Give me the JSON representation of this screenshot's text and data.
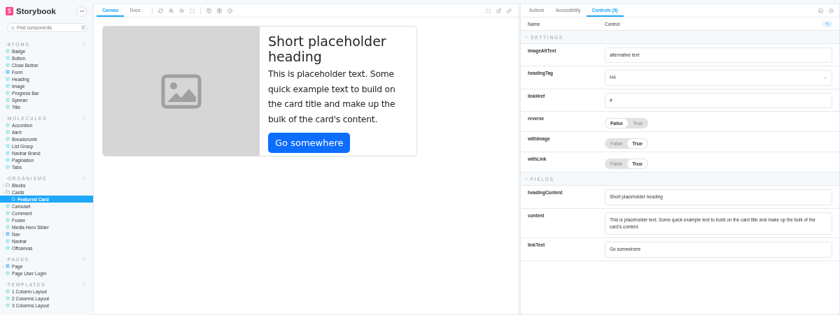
{
  "sidebar": {
    "brand": "Storybook",
    "search": {
      "placeholder": "Find components",
      "shortcut": "/"
    },
    "sections": [
      {
        "title": "ATOMS",
        "items": [
          {
            "label": "Badge",
            "kind": "component",
            "selected": false
          },
          {
            "label": "Button",
            "kind": "component",
            "selected": false
          },
          {
            "label": "Close Button",
            "kind": "component",
            "selected": false
          },
          {
            "label": "Form",
            "kind": "group",
            "expanded": false,
            "selected": false
          },
          {
            "label": "Heading",
            "kind": "component",
            "selected": false
          },
          {
            "label": "Image",
            "kind": "component",
            "selected": false
          },
          {
            "label": "Progress Bar",
            "kind": "component",
            "selected": false
          },
          {
            "label": "Spinner",
            "kind": "component",
            "selected": false
          },
          {
            "label": "Title",
            "kind": "component",
            "selected": false
          }
        ]
      },
      {
        "title": "MOLECULES",
        "items": [
          {
            "label": "Accordion",
            "kind": "component",
            "selected": false
          },
          {
            "label": "Alert",
            "kind": "component",
            "selected": false
          },
          {
            "label": "Breadcrumb",
            "kind": "component",
            "selected": false
          },
          {
            "label": "List Group",
            "kind": "component",
            "selected": false
          },
          {
            "label": "Navbar Brand",
            "kind": "component",
            "selected": false
          },
          {
            "label": "Pagination",
            "kind": "component",
            "selected": false
          },
          {
            "label": "Tabs",
            "kind": "component",
            "selected": false
          }
        ]
      },
      {
        "title": "ORGANISMS",
        "items": [
          {
            "label": "Blocks",
            "kind": "folder",
            "expanded": false,
            "selected": false
          },
          {
            "label": "Cards",
            "kind": "folder",
            "expanded": true,
            "selected": false,
            "children": [
              {
                "label": "Featured Card",
                "kind": "story",
                "selected": true
              }
            ]
          },
          {
            "label": "Carousel",
            "kind": "component",
            "selected": false
          },
          {
            "label": "Comment",
            "kind": "component",
            "selected": false
          },
          {
            "label": "Footer",
            "kind": "component",
            "selected": false
          },
          {
            "label": "Media Hero Slider",
            "kind": "component",
            "selected": false
          },
          {
            "label": "Nav",
            "kind": "group",
            "expanded": false,
            "selected": false
          },
          {
            "label": "Navbar",
            "kind": "component",
            "selected": false
          },
          {
            "label": "Offcanvas",
            "kind": "component",
            "selected": false
          }
        ]
      },
      {
        "title": "PAGES",
        "items": [
          {
            "label": "Page",
            "kind": "group",
            "expanded": false,
            "selected": false
          },
          {
            "label": "Page User Login",
            "kind": "component",
            "selected": false
          }
        ]
      },
      {
        "title": "TEMPLATES",
        "items": [
          {
            "label": "1 Column Layout",
            "kind": "component",
            "selected": false
          },
          {
            "label": "2 Columns Layout",
            "kind": "component",
            "selected": false
          },
          {
            "label": "3 Columns Layout",
            "kind": "component",
            "selected": false
          }
        ]
      }
    ]
  },
  "canvas": {
    "tabs": [
      {
        "label": "Canvas",
        "selected": true
      },
      {
        "label": "Docs",
        "selected": false
      }
    ],
    "card": {
      "heading": "Short placeholder heading",
      "text": "This is placeholder text. Some quick example text to build on the card title and make up the bulk of the card's content.",
      "button": "Go somewhere"
    }
  },
  "addons": {
    "tabs": [
      {
        "label": "Actions",
        "selected": false
      },
      {
        "label": "Accessibility",
        "selected": false
      },
      {
        "label": "Controls (9)",
        "selected": true
      }
    ],
    "columns": [
      "Name",
      "Control"
    ],
    "groups": [
      {
        "title": "SETTINGS",
        "expanded": true,
        "rows": [
          {
            "name": "imageAltText",
            "kind": "text",
            "value": "alternative text"
          },
          {
            "name": "headingTag",
            "kind": "select",
            "value": "H4"
          },
          {
            "name": "linkHref",
            "kind": "text",
            "value": "#"
          },
          {
            "name": "reverse",
            "kind": "toggle",
            "options": [
              "False",
              "True"
            ],
            "on": false
          },
          {
            "name": "withImage",
            "kind": "toggle",
            "options": [
              "False",
              "True"
            ],
            "on": true
          },
          {
            "name": "withLink",
            "kind": "toggle",
            "options": [
              "False",
              "True"
            ],
            "on": true
          }
        ]
      },
      {
        "title": "FIELDS",
        "expanded": true,
        "rows": [
          {
            "name": "headingContent",
            "kind": "text",
            "value": "Short placeholder heading"
          },
          {
            "name": "content",
            "kind": "text",
            "value": "This is placeholder text. Some quick example text to build on the card title and make up the bulk of the card's content."
          },
          {
            "name": "linkText",
            "kind": "text",
            "value": "Go somewhere"
          }
        ]
      }
    ]
  }
}
